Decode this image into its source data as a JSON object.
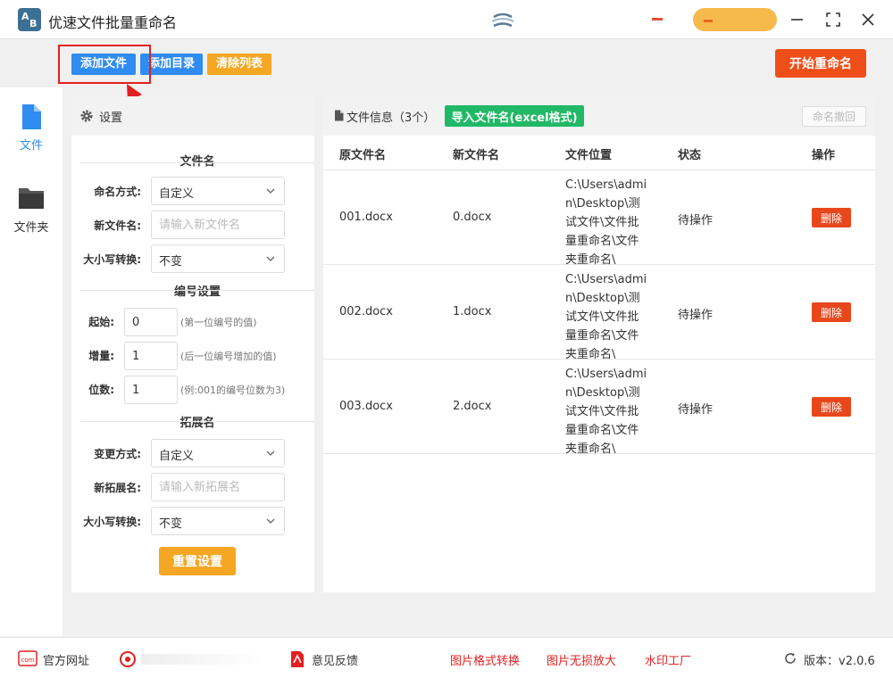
{
  "window": {
    "title": "优速文件批量重命名",
    "logo_text_a": "A",
    "logo_text_b": "B"
  },
  "toolbar": {
    "add_file": "添加文件",
    "add_dir": "添加目录",
    "clear_list": "清除列表",
    "start_rename": "开始重命名"
  },
  "leftnav": {
    "items": [
      {
        "label": "文件"
      },
      {
        "label": "文件夹"
      }
    ]
  },
  "settings": {
    "title": "设置",
    "filename_section": "文件名",
    "naming_mode_label": "命名方式:",
    "naming_mode_value": "自定义",
    "new_name_label": "新文件名:",
    "new_name_placeholder": "请输入新文件名",
    "case_label": "大小写转换:",
    "case_value": "不变",
    "number_section": "编号设置",
    "start_label": "起始:",
    "start_value": "0",
    "start_hint": "(第一位编号的值)",
    "step_label": "增量:",
    "step_value": "1",
    "step_hint": "(后一位编号增加的值)",
    "digits_label": "位数:",
    "digits_value": "1",
    "digits_hint": "(例:001的编号位数为3)",
    "ext_section": "拓展名",
    "ext_mode_label": "变更方式:",
    "ext_mode_value": "自定义",
    "new_ext_label": "新拓展名:",
    "new_ext_placeholder": "请输入新拓展名",
    "ext_case_label": "大小写转换:",
    "ext_case_value": "不变",
    "reset": "重置设置"
  },
  "fileinfo": {
    "title": "文件信息（3个）",
    "import_excel": "导入文件名(excel格式)",
    "undo": "命名撤回",
    "columns": [
      "原文件名",
      "新文件名",
      "文件位置",
      "状态",
      "操作"
    ],
    "rows": [
      {
        "orig": "001.docx",
        "new": "0.docx",
        "location": "C:\\Users\\admin\\Desktop\\测试文件\\文件批量重命名\\文件夹重命名\\",
        "status": "待操作",
        "action": "删除"
      },
      {
        "orig": "002.docx",
        "new": "1.docx",
        "location": "C:\\Users\\admin\\Desktop\\测试文件\\文件批量重命名\\文件夹重命名\\",
        "status": "待操作",
        "action": "删除"
      },
      {
        "orig": "003.docx",
        "new": "2.docx",
        "location": "C:\\Users\\admin\\Desktop\\测试文件\\文件批量重命名\\文件夹重命名\\",
        "status": "待操作",
        "action": "删除"
      }
    ]
  },
  "footer": {
    "official_site": "官方网址",
    "feedback": "意见反馈",
    "img_convert": "图片格式转换",
    "img_enlarge": "图片无损放大",
    "watermark": "水印工厂",
    "version": "版本：v2.0.6",
    "com_badge": "com"
  },
  "colors": {
    "primary_blue": "#2f8cf0",
    "orange": "#f5a623",
    "start_red": "#ef4e19",
    "green": "#21b866",
    "delete_red": "#e8471c",
    "highlight_red": "#e02020"
  }
}
